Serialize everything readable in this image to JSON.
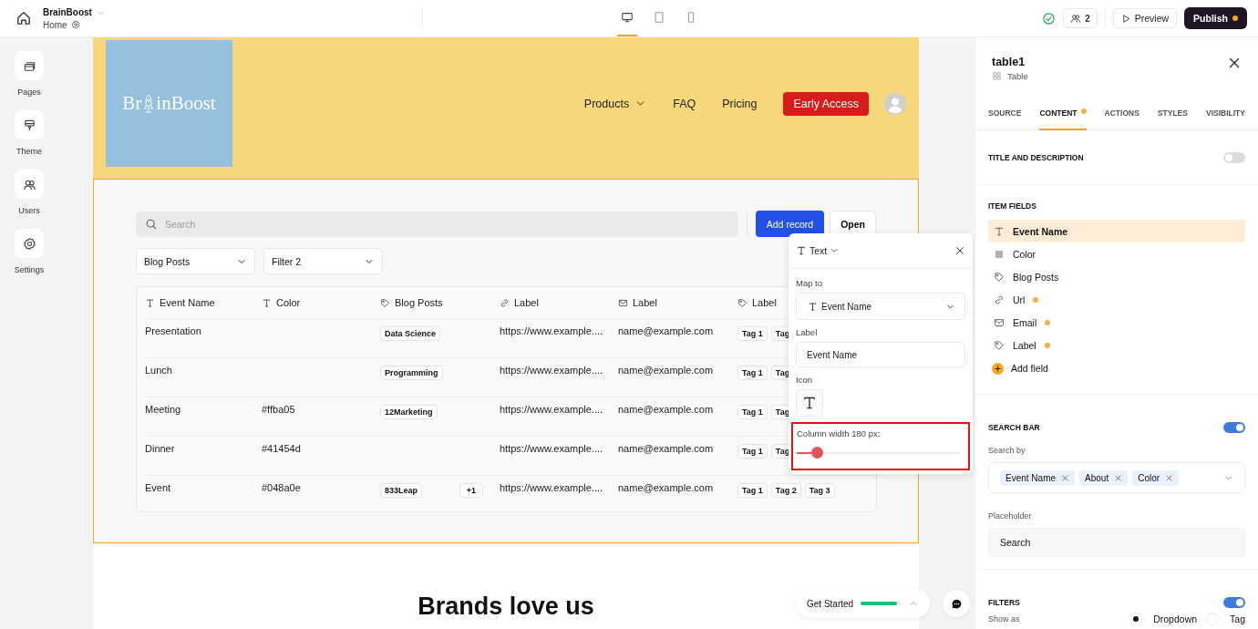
{
  "topbar": {
    "app_name": "BrainBoost",
    "page_name": "Home",
    "devices": [
      {
        "kind": "desktop",
        "selected": true
      },
      {
        "kind": "tablet",
        "selected": false
      },
      {
        "kind": "phone",
        "selected": false
      }
    ],
    "collaborators": "2",
    "preview": "Preview",
    "publish": "Publish",
    "publish_pending": true
  },
  "rail": [
    {
      "kind": "pages",
      "label": "Pages"
    },
    {
      "kind": "theme",
      "label": "Theme"
    },
    {
      "kind": "users",
      "label": "Users"
    },
    {
      "kind": "settings",
      "label": "Settings"
    }
  ],
  "site": {
    "logo": {
      "before": "Br",
      "after": "inBoost"
    },
    "nav": [
      {
        "label": "Products",
        "dropdown": true
      },
      {
        "label": "FAQ",
        "dropdown": false
      },
      {
        "label": "Pricing",
        "dropdown": false
      }
    ],
    "cta": "Early Access",
    "section_heading": "Brands love us"
  },
  "table": {
    "search_placeholder": "Search",
    "add_button": "Add record",
    "open_button": "Open",
    "filters": [
      "Blog Posts",
      "Filter 2"
    ],
    "columns": [
      {
        "kind": "text",
        "label": "Event Name"
      },
      {
        "kind": "text",
        "label": "Color"
      },
      {
        "kind": "tag",
        "label": "Blog Posts"
      },
      {
        "kind": "link",
        "label": "Label"
      },
      {
        "kind": "email",
        "label": "Label"
      },
      {
        "kind": "tag",
        "label": "Label"
      }
    ],
    "rows": [
      {
        "event_name": "Presentation",
        "blog_posts": [
          "Data Science"
        ],
        "url": "https://www.example....",
        "email": "name@example.com",
        "tags": [
          "Tag 1",
          "Tag"
        ]
      },
      {
        "event_name": "Lunch",
        "blog_posts": [
          "Programming"
        ],
        "url": "https://www.example....",
        "email": "name@example.com",
        "tags": [
          "Tag 1",
          "Tag"
        ]
      },
      {
        "event_name": "Meeting",
        "color_text": "#ffba05",
        "blog_posts": [
          "12Marketing"
        ],
        "url": "https://www.example....",
        "email": "name@example.com",
        "tags": [
          "Tag 1",
          "Tag"
        ]
      },
      {
        "event_name": "Dinner",
        "color_text": "#41454d",
        "url": "https://www.example....",
        "email": "name@example.com",
        "tags": [
          "Tag 1",
          "Tag"
        ]
      },
      {
        "event_name": "Event",
        "color_text": "#048a0e",
        "blog_posts": [
          "833Leap"
        ],
        "blog_posts_more": "+1",
        "url": "https://www.example....",
        "email": "name@example.com",
        "tags": [
          "Tag 1",
          "Tag 2",
          "Tag 3"
        ]
      }
    ]
  },
  "popover": {
    "type_label": "Text",
    "map_to_label": "Map to",
    "map_to_value": "Event Name",
    "label_label": "Label",
    "label_value": "Event Name",
    "icon_label": "Icon",
    "width_label": "Column width 180 px:",
    "level": 0.12,
    "highlighted": true
  },
  "panel": {
    "title": "table1",
    "subtitle": "Table",
    "tabs": [
      {
        "label": "SOURCE",
        "selected": false,
        "flagged": false
      },
      {
        "label": "CONTENT",
        "selected": true,
        "flagged": true
      },
      {
        "label": "ACTIONS",
        "selected": false,
        "flagged": false
      },
      {
        "label": "STYLES",
        "selected": false,
        "flagged": false
      },
      {
        "label": "VISIBILITY",
        "selected": false,
        "flagged": false
      }
    ],
    "title_description": {
      "label": "TITLE AND DESCRIPTION",
      "on": false
    },
    "item_fields": {
      "heading": "ITEM FIELDS",
      "items": [
        {
          "kind": "text",
          "label": "Event Name",
          "selected": true,
          "flagged": false
        },
        {
          "kind": "list",
          "label": "Color",
          "selected": false,
          "flagged": false
        },
        {
          "kind": "tag",
          "label": "Blog Posts",
          "selected": false,
          "flagged": false
        },
        {
          "kind": "link",
          "label": "Url",
          "selected": false,
          "flagged": true
        },
        {
          "kind": "email",
          "label": "Email",
          "selected": false,
          "flagged": true
        },
        {
          "kind": "tag",
          "label": "Label",
          "selected": false,
          "flagged": true
        }
      ],
      "add": "Add field"
    },
    "search_bar": {
      "heading": "SEARCH BAR",
      "on": true,
      "search_by_label": "Search by",
      "chips": [
        "Event Name",
        "About",
        "Color"
      ],
      "placeholder_label": "Placeholder",
      "placeholder_value": "Search"
    },
    "filters": {
      "heading": "FILTERS",
      "on": true,
      "show_as_label": "Show as",
      "options": [
        {
          "label": "Dropdown",
          "selected": true
        },
        {
          "label": "Tag",
          "selected": false
        }
      ]
    }
  },
  "widgets": {
    "get_started": "Get Started",
    "level": 0.9
  }
}
